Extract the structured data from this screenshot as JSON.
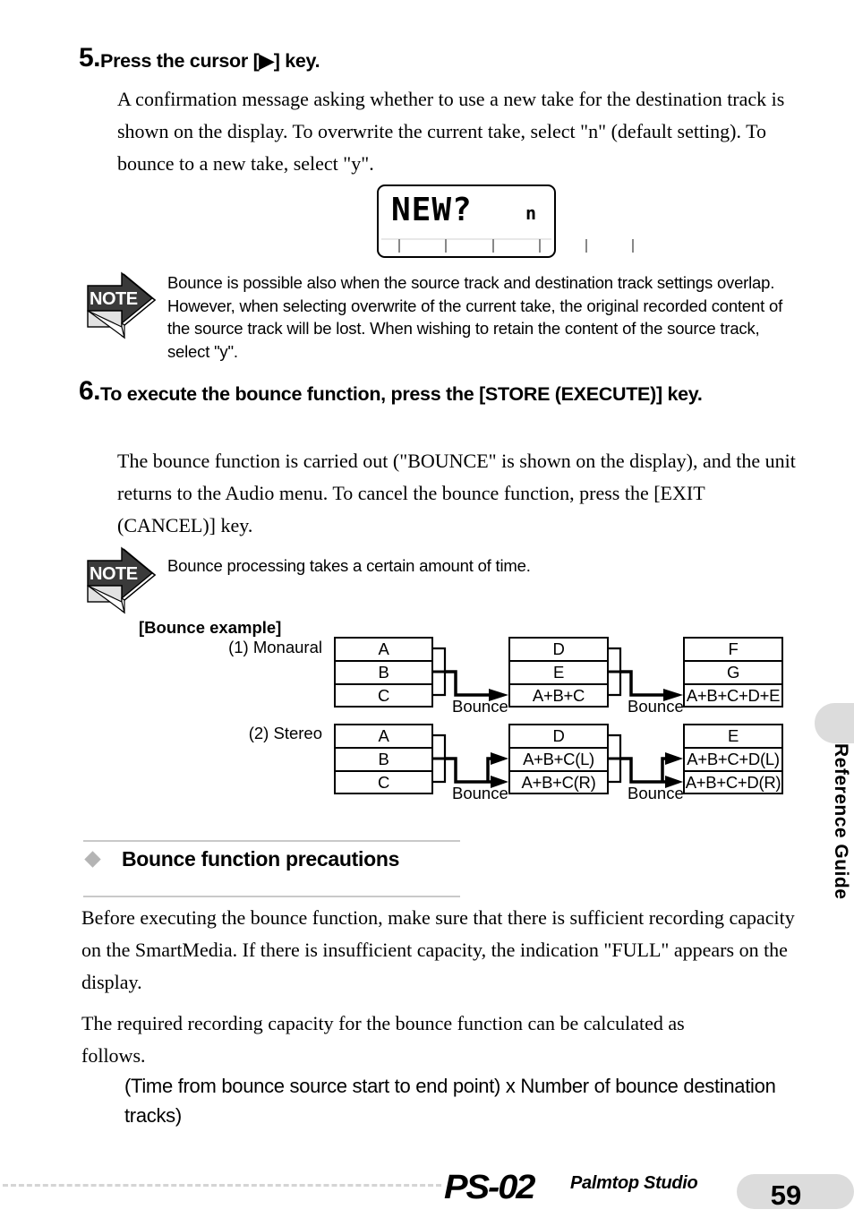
{
  "steps": [
    {
      "number": "5.",
      "title": "Press the cursor [▶] key.",
      "body": "A confirmation message asking whether to use a new take for the destination track is shown on the display. To overwrite the current take, select \"n\" (default setting). To bounce to a new take, select \"y\"."
    },
    {
      "number": "6.",
      "title": "To execute the bounce function, press the [STORE (EXECUTE)] key.",
      "body": "The bounce function is carried out (\"BOUNCE\" is shown on the display), and the unit returns to the Audio menu. To cancel the bounce function, press the [EXIT (CANCEL)] key."
    }
  ],
  "lcd": {
    "main_text": "NEW?",
    "right_value": "n",
    "tick_count": 6
  },
  "notes": [
    {
      "icon_label": "NOTE",
      "text": "Bounce is possible also when the source track and destination track settings overlap. However, when selecting overwrite of the current take, the original recorded content of the source track will be lost. When wishing to retain the content of the source track, select \"y\"."
    },
    {
      "icon_label": "NOTE",
      "text": "Bounce processing takes a certain amount of time."
    }
  ],
  "diagram": {
    "title": "[Bounce example]",
    "bounce_label": "Bounce",
    "rows": [
      {
        "label": "(1) Monaural",
        "mode": "mono",
        "boxes": [
          {
            "cells": [
              "A",
              "B",
              "C"
            ]
          },
          {
            "cells": [
              "D",
              "E",
              "A+B+C"
            ]
          },
          {
            "cells": [
              "F",
              "G",
              "A+B+C+D+E"
            ]
          }
        ]
      },
      {
        "label": "(2) Stereo",
        "mode": "stereo",
        "boxes": [
          {
            "cells": [
              "A",
              "B",
              "C"
            ]
          },
          {
            "cells": [
              "D",
              "A+B+C(L)",
              "A+B+C(R)"
            ]
          },
          {
            "cells": [
              "E",
              "A+B+C+D(L)",
              "A+B+C+D(R)"
            ]
          }
        ]
      }
    ]
  },
  "section": {
    "heading": "Bounce function precautions",
    "paragraph1": "Before executing the bounce function, make sure that there is sufficient recording capacity on the SmartMedia. If there is insufficient capacity, the indication \"FULL\" appears on the display.",
    "paragraph2": "The required recording capacity for the bounce function can be calculated as follows.",
    "formula": "(Time from bounce source start to end point) x Number of bounce destination tracks)"
  },
  "side_tab": {
    "label": "Reference Guide"
  },
  "footer": {
    "logo": "PS-02",
    "subtitle": "Palmtop Studio",
    "page_number": "59"
  },
  "colors": {
    "accent_gray": "#dcdcdc",
    "rule_gray": "#c9c9c9",
    "note_dark": "#3a3a3a",
    "note_light": "#e2e2e2"
  }
}
